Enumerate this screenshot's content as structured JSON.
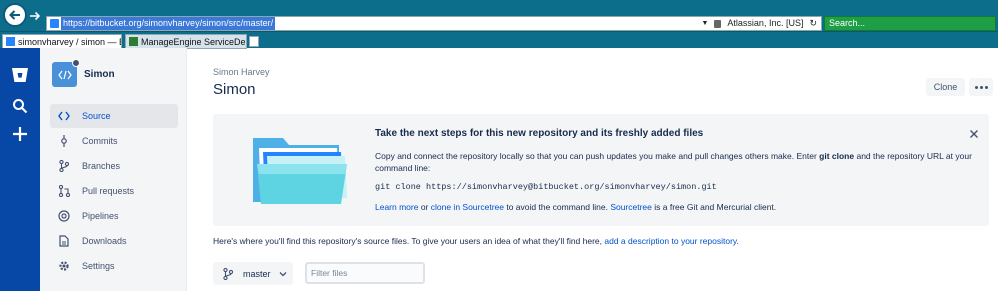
{
  "browser": {
    "url": "https://bitbucket.org/simonvharvey/simon/src/master/",
    "site_identity": "Atlassian, Inc. [US]",
    "search_placeholder": "Search...",
    "tabs": [
      {
        "label": "simonvharvey / simon — Bi..."
      },
      {
        "label": "ManageEngine ServiceDesk Pl..."
      }
    ]
  },
  "global_nav": {
    "items": [
      "bitbucket-logo-icon",
      "search-icon",
      "create-icon"
    ]
  },
  "repo": {
    "name": "Simon",
    "owner": "Simon Harvey",
    "nav": [
      {
        "label": "Source",
        "icon": "source-icon",
        "selected": true
      },
      {
        "label": "Commits",
        "icon": "commits-icon"
      },
      {
        "label": "Branches",
        "icon": "branches-icon"
      },
      {
        "label": "Pull requests",
        "icon": "pull-requests-icon"
      },
      {
        "label": "Pipelines",
        "icon": "pipelines-icon"
      },
      {
        "label": "Downloads",
        "icon": "downloads-icon"
      },
      {
        "label": "Settings",
        "icon": "settings-icon"
      }
    ]
  },
  "header": {
    "clone_label": "Clone"
  },
  "banner": {
    "title": "Take the next steps for this new repository and its freshly added files",
    "text_before": "Copy and connect the repository locally so that you can push updates you make and pull changes others make. Enter ",
    "text_bold": "git clone",
    "text_after": " and the repository URL at your command line:",
    "command": "git clone https://simonvharvey@bitbucket.org/simonvharvey/simon.git",
    "link_learn_more": "Learn more",
    "text_or": " or ",
    "link_sourcetree_clone": "clone in Sourcetree",
    "text_avoid": " to avoid the command line. ",
    "link_sourcetree": "Sourcetree",
    "text_client": " is a free Git and Mercurial client."
  },
  "source": {
    "info_text": "Here's where you'll find this repository's source files. To give your users an idea of what they'll find here, ",
    "info_link": "add a description to your repository",
    "info_end": ".",
    "branch": "master",
    "filter_placeholder": "Filter files"
  },
  "colors": {
    "global_nav": "#0747a6",
    "link": "#0052cc",
    "browser_chrome": "#0d6e8c"
  }
}
